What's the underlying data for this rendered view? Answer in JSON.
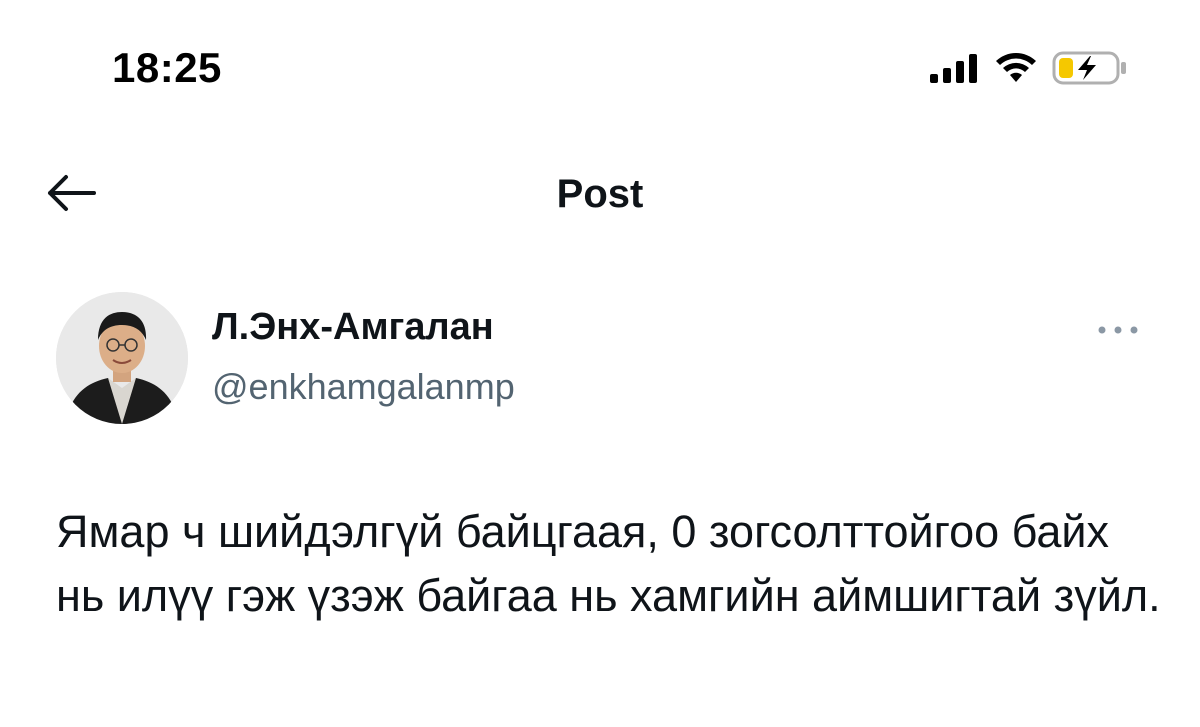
{
  "status_bar": {
    "time": "18:25",
    "icons": [
      "cellular-signal-icon",
      "wifi-icon",
      "battery-charging-icon"
    ]
  },
  "nav": {
    "back_icon": "arrow-left-icon",
    "title": "Post"
  },
  "post": {
    "author": {
      "name": "Л.Энх-Амгалан",
      "handle": "@enkhamgalanmp"
    },
    "more_icon": "more-dots-icon",
    "text": "Ямар ч шийдэлгүй байцгаая, 0 зогсолттойгоо байх нь илүү гэж үзэж байгаа нь хамгийн аймшигтай зүйл."
  },
  "colors": {
    "text_primary": "#0f1419",
    "text_secondary": "#536471",
    "battery_charge": "#f5c800"
  }
}
